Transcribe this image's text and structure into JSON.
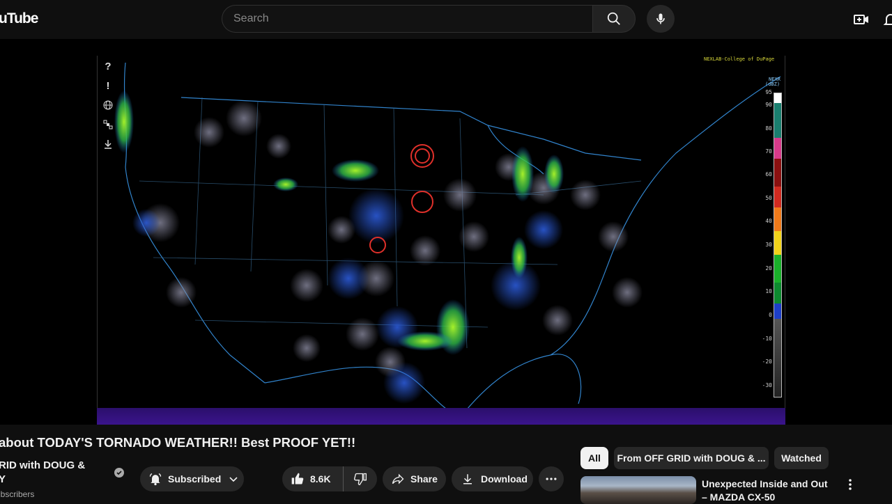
{
  "header": {
    "logo_text": "uTube",
    "search_placeholder": "Search"
  },
  "icons": {
    "search": "search-icon",
    "mic": "mic-icon",
    "create": "create-video-icon",
    "notifications": "bell-icon"
  },
  "radar": {
    "credit": "NEXLAB-College of DuPage",
    "product": "NEXR",
    "unit": "(dBZ)",
    "scale_labels": [
      "95",
      "90",
      "80",
      "70",
      "60",
      "50",
      "40",
      "30",
      "20",
      "10",
      "0",
      "-10",
      "-20",
      "-30"
    ],
    "tools": [
      "?",
      "!",
      "globe-icon",
      "satellite-icon",
      "download-icon"
    ]
  },
  "video": {
    "title": "about TODAY'S TORNADO WEATHER!! Best PROOF YET!!",
    "channel_name_line1": "RID with DOUG &",
    "channel_name_line2": "Y",
    "subscribers": "ubscribers",
    "subscribed_label": "Subscribed",
    "like_count": "8.6K",
    "share_label": "Share",
    "download_label": "Download"
  },
  "sidebar": {
    "chips": [
      {
        "label": "All",
        "active": true
      },
      {
        "label": "From OFF GRID with DOUG & ...",
        "active": false
      },
      {
        "label": "Watched",
        "active": false
      }
    ],
    "recommendations": [
      {
        "title": "Unexpected Inside and Out – MAZDA CX-50"
      }
    ]
  },
  "colors": {
    "background": "#0f0f0f",
    "pill": "#272727",
    "radar_accent": "#4aa8ff",
    "purple_bar": "#3a148c"
  }
}
